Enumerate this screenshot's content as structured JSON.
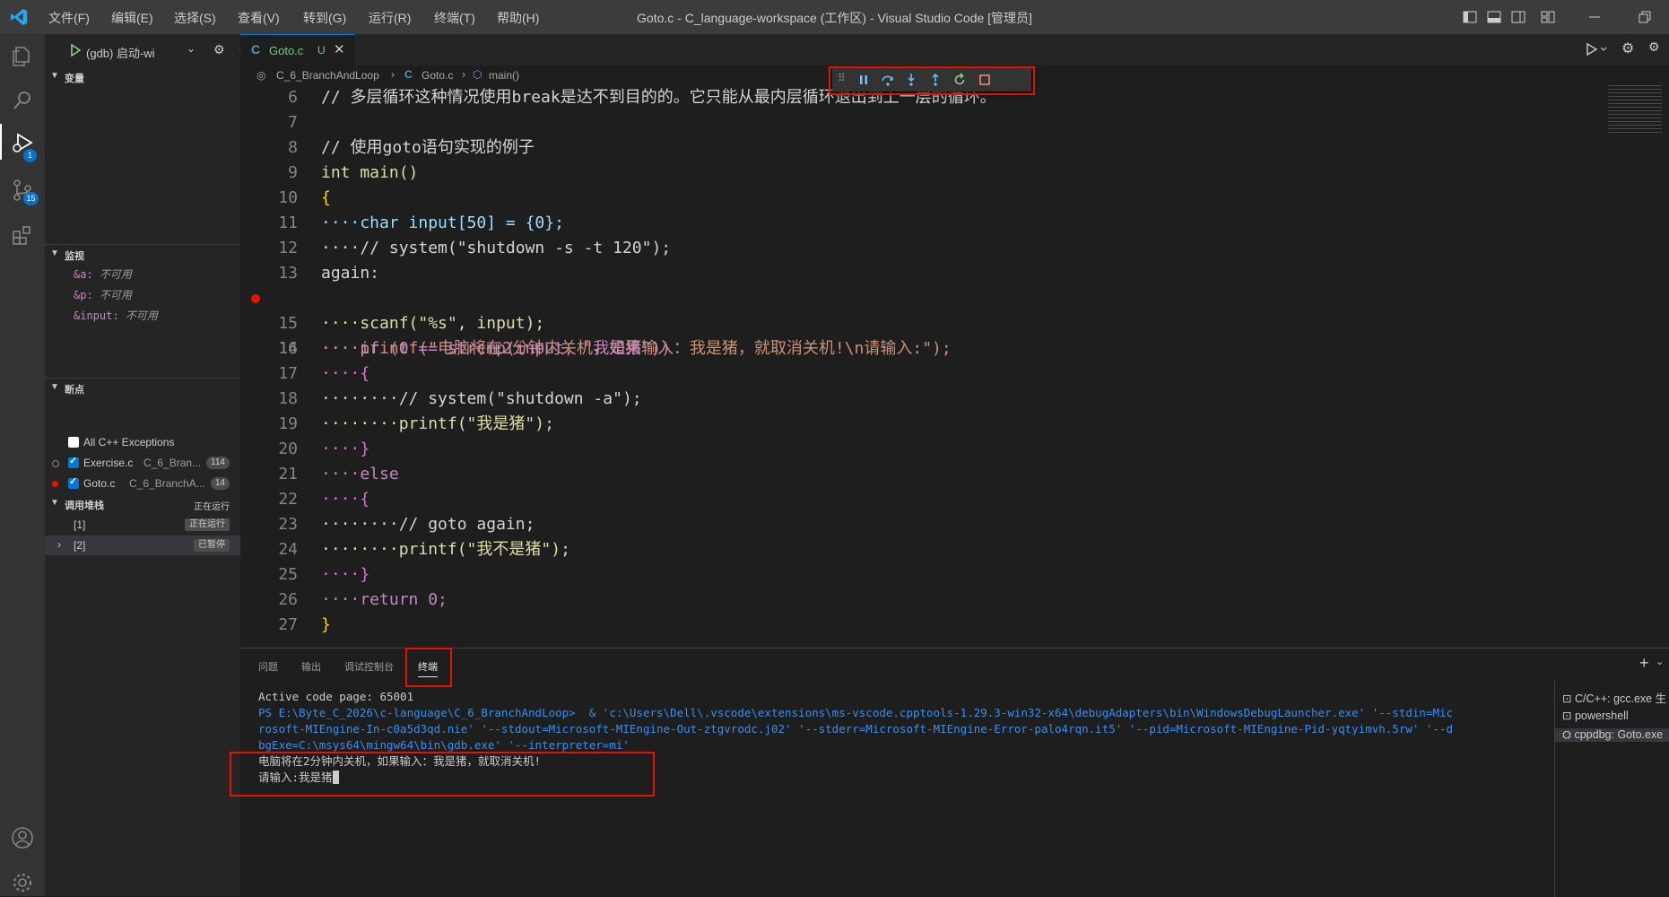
{
  "window": {
    "title": "Goto.c - C_language-workspace (工作区) - Visual Studio Code [管理员]"
  },
  "menu": [
    "文件(F)",
    "编辑(E)",
    "选择(S)",
    "查看(V)",
    "转到(G)",
    "运行(R)",
    "终端(T)",
    "帮助(H)"
  ],
  "activity_badges": {
    "debug": "1",
    "scm": "15"
  },
  "debug_launch": {
    "config": "(gdb) 启动-wi"
  },
  "sidebar": {
    "variables_header": "变量",
    "watch_header": "监视",
    "watch": [
      {
        "expr": "&a:",
        "value": "不可用"
      },
      {
        "expr": "&p:",
        "value": "不可用"
      },
      {
        "expr": "&input:",
        "value": "不可用"
      }
    ],
    "breakpoints_header": "断点",
    "breakpoints": [
      {
        "name": "All C++ Exceptions",
        "path": "",
        "line": "",
        "checked": false
      },
      {
        "name": "Exercise.c",
        "path": "C_6_Bran...",
        "line": "114",
        "checked": true
      },
      {
        "name": "Goto.c",
        "path": "C_6_BranchA...",
        "line": "14",
        "checked": true
      }
    ],
    "callstack_header": "调用堆栈",
    "callstack_status": "正在运行",
    "callstack": [
      {
        "name": "[1]",
        "status": "正在运行"
      },
      {
        "name": "[2]",
        "status": "已暂停"
      }
    ]
  },
  "editor": {
    "tab": {
      "name": "Goto.c",
      "status": "U"
    },
    "breadcrumb": [
      "C_6_BranchAndLoop",
      "Goto.c",
      "main()"
    ],
    "lines": [
      {
        "n": "6",
        "text": "// 多层循环这种情况使用break是达不到目的的。它只能从最内层循环退出到上一层的循环。"
      },
      {
        "n": "7",
        "text": ""
      },
      {
        "n": "8",
        "text": "// 使用goto语句实现的例子"
      },
      {
        "n": "9",
        "text": "int main()"
      },
      {
        "n": "10",
        "text": "{"
      },
      {
        "n": "11",
        "text": "····char input[50] = {0};"
      },
      {
        "n": "12",
        "text": "····// system(\"shutdown -s -t 120\");"
      },
      {
        "n": "13",
        "text": "again:"
      },
      {
        "n": "14",
        "text": "····printf(\"电脑将在2分钟内关机，如果输入：我是猪，就取消关机!\\n请输入:\");"
      },
      {
        "n": "15",
        "text": "····scanf(\"%s\", input);"
      },
      {
        "n": "16",
        "text": "····if (0 == strcmp(input, \"我是猪\"))"
      },
      {
        "n": "17",
        "text": "····{"
      },
      {
        "n": "18",
        "text": "········// system(\"shutdown -a\");"
      },
      {
        "n": "19",
        "text": "········printf(\"我是猪\");"
      },
      {
        "n": "20",
        "text": "····}"
      },
      {
        "n": "21",
        "text": "····else"
      },
      {
        "n": "22",
        "text": "····{"
      },
      {
        "n": "23",
        "text": "········// goto again;"
      },
      {
        "n": "24",
        "text": "········printf(\"我不是猪\");"
      },
      {
        "n": "25",
        "text": "····}"
      },
      {
        "n": "26",
        "text": "····return 0;"
      },
      {
        "n": "27",
        "text": "}"
      }
    ]
  },
  "panel": {
    "tabs": [
      "问题",
      "输出",
      "调试控制台",
      "终端"
    ],
    "terminal_lines": [
      "Active code page: 65001",
      "PS E:\\Byte_C_2026\\c-language\\C_6_BranchAndLoop>  & 'c:\\Users\\Dell\\.vscode\\extensions\\ms-vscode.cpptools-1.29.3-win32-x64\\debugAdapters\\bin\\WindowsDebugLauncher.exe' '--stdin=Mic",
      "rosoft-MIEngine-In-c0a5d3qd.nie' '--stdout=Microsoft-MIEngine-Out-ztgvrodc.j02' '--stderr=Microsoft-MIEngine-Error-palo4rqn.it5' '--pid=Microsoft-MIEngine-Pid-yqtyimvh.5rw' '--d",
      "bgExe=C:\\msys64\\mingw64\\bin\\gdb.exe' '--interpreter=mi'",
      "电脑将在2分钟内关机，如果输入：我是猪，就取消关机!",
      "请输入:我是猪"
    ],
    "terminal_list": [
      "C/C++: gcc.exe 生",
      "powershell",
      "cppdbg: Goto.exe"
    ]
  },
  "colors": {
    "accent": "#0078d4",
    "highlight_box": "#e51400",
    "breakpoint": "#e51400"
  }
}
